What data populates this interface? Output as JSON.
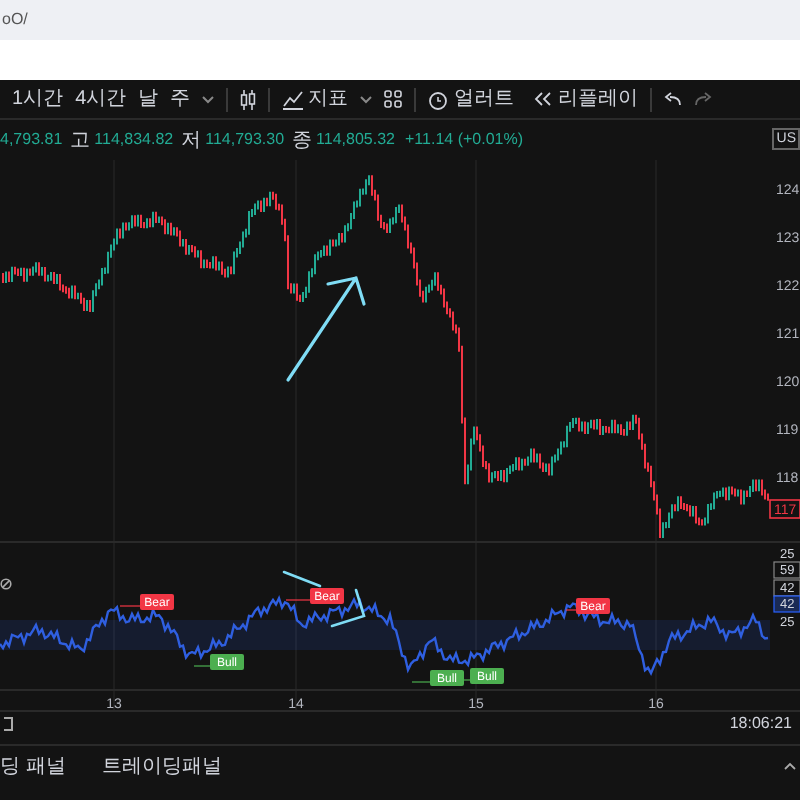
{
  "browser": {
    "address": "oO/"
  },
  "toolbar": {
    "intervals": [
      {
        "label": "1시간"
      },
      {
        "label": "4시간"
      },
      {
        "label": "날"
      },
      {
        "label": "주"
      }
    ],
    "indicators_label": "지표",
    "alert_label": "얼러트",
    "replay_label": "리플레이"
  },
  "ohlc": {
    "open": "4,793.81",
    "high_label": "고",
    "high": "114,834.82",
    "low_label": "저",
    "low": "114,793.30",
    "close_label": "종",
    "close": "114,805.32",
    "change": "+11.14 (+0.01%)"
  },
  "price_axis": {
    "currency": "US",
    "ticks": [
      "124",
      "123",
      "122",
      "121",
      "120",
      "119",
      "118"
    ],
    "last_price": "117"
  },
  "rsi": {
    "signals": [
      {
        "kind": "bear",
        "label": "Bear"
      },
      {
        "kind": "bull",
        "label": "Bull"
      },
      {
        "kind": "bear",
        "label": "Bear"
      },
      {
        "kind": "bull",
        "label": "Bull"
      },
      {
        "kind": "bull",
        "label": "Bull"
      },
      {
        "kind": "bear",
        "label": "Bear"
      }
    ],
    "axis": [
      "25",
      "59",
      "42",
      "42",
      "25"
    ]
  },
  "time_axis": [
    "13",
    "14",
    "15",
    "16"
  ],
  "clock": "18:06:21",
  "bottom_tabs": [
    {
      "label": "딩 패널"
    },
    {
      "label": "트레이딩패널"
    }
  ]
}
